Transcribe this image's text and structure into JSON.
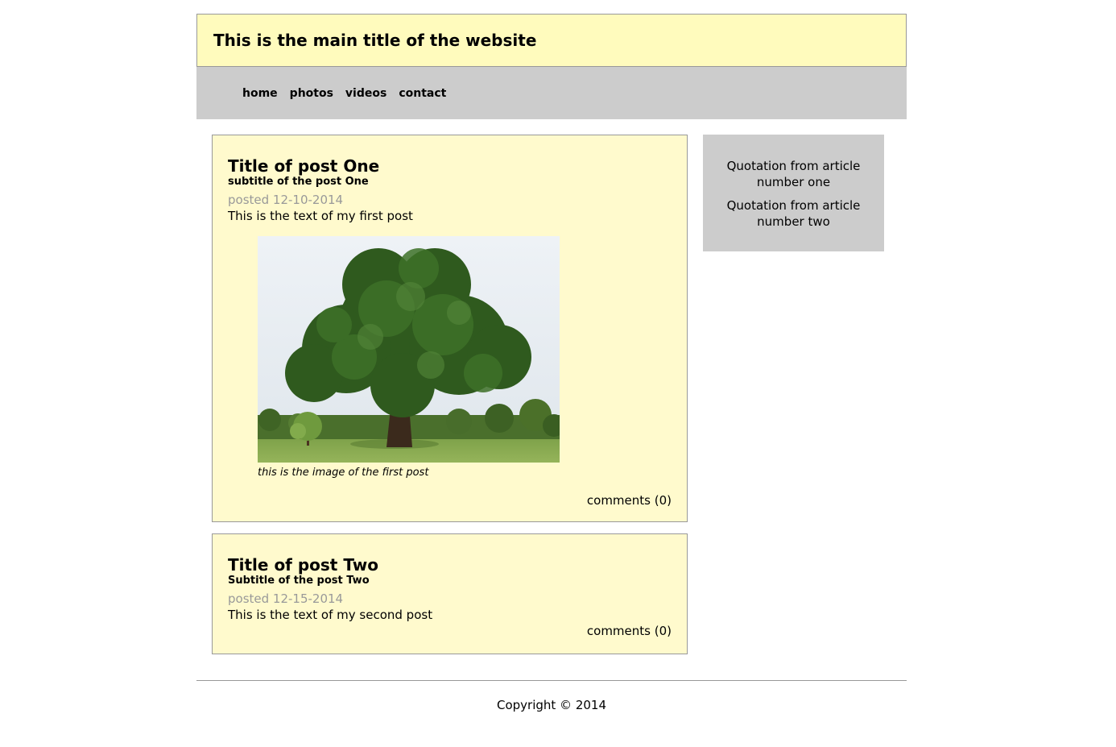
{
  "header": {
    "title": "This is the main title of the website"
  },
  "nav": {
    "items": [
      {
        "label": "home"
      },
      {
        "label": "photos"
      },
      {
        "label": "videos"
      },
      {
        "label": "contact"
      }
    ]
  },
  "posts": [
    {
      "title": "Title of post One",
      "subtitle": "subtitle of the post One",
      "date": "posted 12-10-2014",
      "text": "This is the text of my first post",
      "image_caption": "this is the image of the first post",
      "comments": "comments (0)"
    },
    {
      "title": "Title of post Two",
      "subtitle": "Subtitle of the post Two",
      "date": "posted 12-15-2014",
      "text": "This is the text of my second post",
      "comments": "comments (0)"
    }
  ],
  "sidebar": {
    "quotes": [
      "Quotation from article number one",
      "Quotation from article number two"
    ]
  },
  "footer": {
    "copyright": "Copyright © 2014"
  }
}
